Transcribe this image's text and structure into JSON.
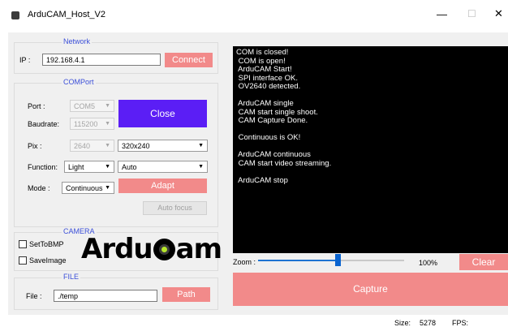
{
  "window": {
    "title": "ArduCAM_Host_V2",
    "minimize": "—",
    "maximize": "☐",
    "close": "✕"
  },
  "network": {
    "title": "Network",
    "ip_label": "IP :",
    "ip_value": "192.168.4.1",
    "connect_label": "Connect"
  },
  "comport": {
    "title": "COMPort",
    "port_label": "Port   :",
    "port_value": "COM5",
    "baudrate_label": "Baudrate:",
    "baudrate_value": "115200",
    "close_label": "Close",
    "pix_label": "Pix    :",
    "pix_value": "2640",
    "resolution_value": "320x240",
    "function_label": "Function:",
    "function_value": "Light",
    "function_mode_value": "Auto",
    "mode_label": "Mode   :",
    "mode_value": "Continuous",
    "adapt_label": "Adapt",
    "autofocus_label": "Auto focus"
  },
  "camera": {
    "title": "CAMERA",
    "set_to_bmp_label": "SetToBMP",
    "save_image_label": "SaveImage",
    "logo_text_left": "Ardu",
    "logo_text_right": "am"
  },
  "file": {
    "title": "FILE",
    "file_label": "File :",
    "path_value": "./temp",
    "path_button_label": "Path"
  },
  "console": {
    "lines": "COM is closed!\n COM is open!\n ArduCAM Start!\n SPI interface OK.\n OV2640 detected.\n\n ArduCAM single\n CAM start single shoot.\n CAM Capture Done.\n\n Continuous is OK!\n\n ArduCAM continuous\n CAM start video streaming.\n\n ArduCAM stop"
  },
  "zoom": {
    "label": "Zoom :",
    "value_text": "100%",
    "slider_fraction": 0.54,
    "clear_label": "Clear"
  },
  "capture": {
    "label": "Capture"
  },
  "status": {
    "size_label": "Size:",
    "size_value": "5278",
    "fps_label": "FPS:",
    "fps_value": ""
  },
  "colors": {
    "accent_pink": "#f28a8a",
    "accent_purple": "#5b1ef5",
    "group_title_blue": "#3b4fd8",
    "slider_blue": "#0a64d0"
  }
}
